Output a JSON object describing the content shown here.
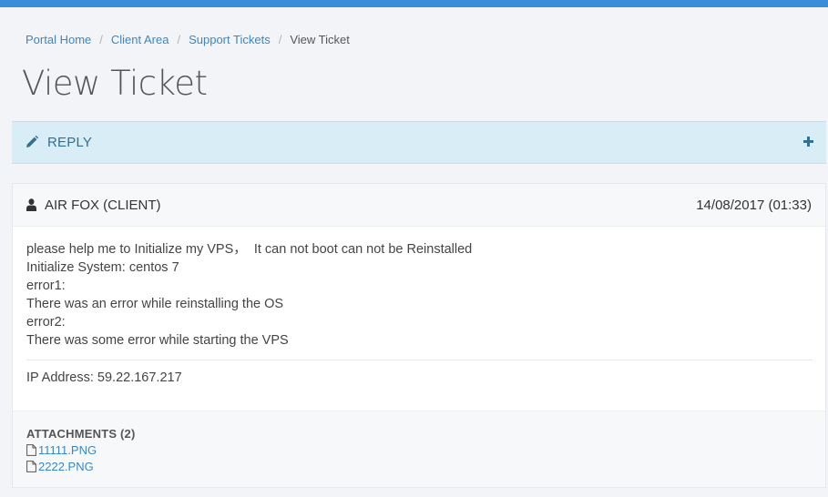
{
  "breadcrumb": {
    "items": [
      "Portal Home",
      "Client Area",
      "Support Tickets"
    ],
    "separator": "/",
    "current": "View Ticket"
  },
  "page": {
    "title": "View Ticket"
  },
  "reply_panel": {
    "label": "REPLY",
    "icon": "pencil-icon",
    "toggle_icon": "plus-icon"
  },
  "message": {
    "author": "AIR FOX (CLIENT)",
    "date": "14/08/2017 (01:33)",
    "lines": [
      "please help me to Initialize my VPS，  It can not boot can not be Reinstalled",
      "Initialize System: centos 7",
      "error1:",
      "There was an error while reinstalling the OS",
      "error2:",
      "There was some error while starting the VPS"
    ],
    "ip": "IP Address: 59.22.167.217"
  },
  "attachments": {
    "title": "ATTACHMENTS (2)",
    "files": [
      "11111.PNG",
      "2222.PNG"
    ]
  },
  "colors": {
    "top_bar": "#3c8dd9",
    "link": "#3a87c7",
    "reply_bg": "#d9edf7",
    "reply_text": "#31708f"
  }
}
